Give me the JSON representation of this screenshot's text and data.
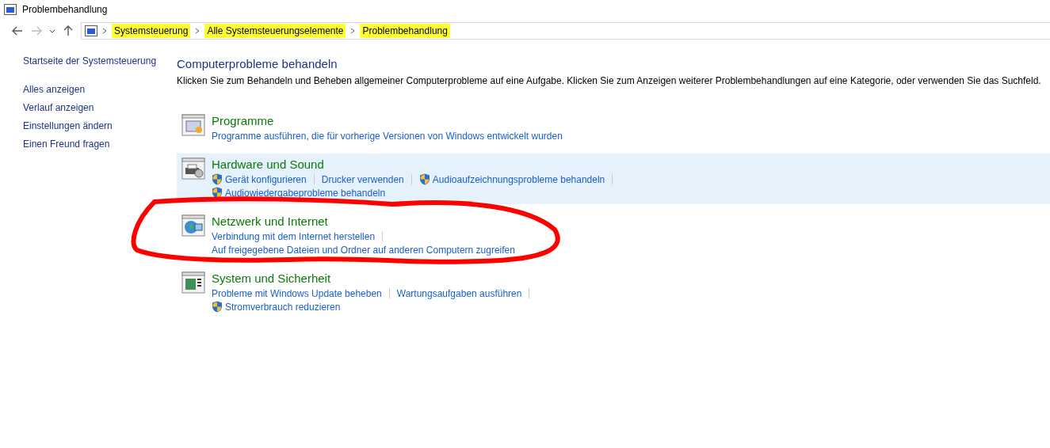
{
  "window": {
    "title": "Problembehandlung"
  },
  "breadcrumb": [
    {
      "label": "Systemsteuerung",
      "highlighted": true
    },
    {
      "label": "Alle Systemsteuerungselemente",
      "highlighted": true
    },
    {
      "label": "Problembehandlung",
      "highlighted": true
    }
  ],
  "sidebar": {
    "home": "Startseite der Systemsteuerung",
    "items": [
      "Alles anzeigen",
      "Verlauf anzeigen",
      "Einstellungen ändern",
      "Einen Freund fragen"
    ]
  },
  "main": {
    "heading": "Computerprobleme behandeln",
    "description": "Klicken Sie zum Behandeln und Beheben allgemeiner Computerprobleme auf eine Aufgabe. Klicken Sie zum Anzeigen weiterer Problembehandlungen auf eine Kategorie, oder verwenden Sie das Suchfeld.",
    "categories": [
      {
        "kind": "programs",
        "title": "Programme",
        "highlighted": false,
        "circled": false,
        "link_rows": [
          [
            {
              "label": "Programme ausführen, die für vorherige Versionen von Windows entwickelt wurden",
              "shield": false
            }
          ]
        ]
      },
      {
        "kind": "hardware",
        "title": "Hardware und Sound",
        "highlighted": true,
        "circled": false,
        "link_rows": [
          [
            {
              "label": "Gerät konfigurieren",
              "shield": true
            },
            {
              "label": "Drucker verwenden",
              "shield": false
            },
            {
              "label": "Audioaufzeichnungsprobleme behandeln",
              "shield": true
            }
          ],
          [
            {
              "label": "Audiowiedergabeprobleme behandeln",
              "shield": true
            }
          ]
        ]
      },
      {
        "kind": "network",
        "title": "Netzwerk und Internet",
        "highlighted": false,
        "circled": true,
        "link_rows": [
          [
            {
              "label": "Verbindung mit dem Internet herstellen",
              "shield": false
            }
          ],
          [
            {
              "label": "Auf freigegebene Dateien und Ordner auf anderen Computern zugreifen",
              "shield": false
            }
          ]
        ]
      },
      {
        "kind": "system",
        "title": "System und Sicherheit",
        "highlighted": false,
        "circled": false,
        "link_rows": [
          [
            {
              "label": "Probleme mit Windows Update beheben",
              "shield": false
            },
            {
              "label": "Wartungsaufgaben ausführen",
              "shield": false
            }
          ],
          [
            {
              "label": "Stromverbrauch reduzieren",
              "shield": true
            }
          ]
        ]
      }
    ]
  }
}
